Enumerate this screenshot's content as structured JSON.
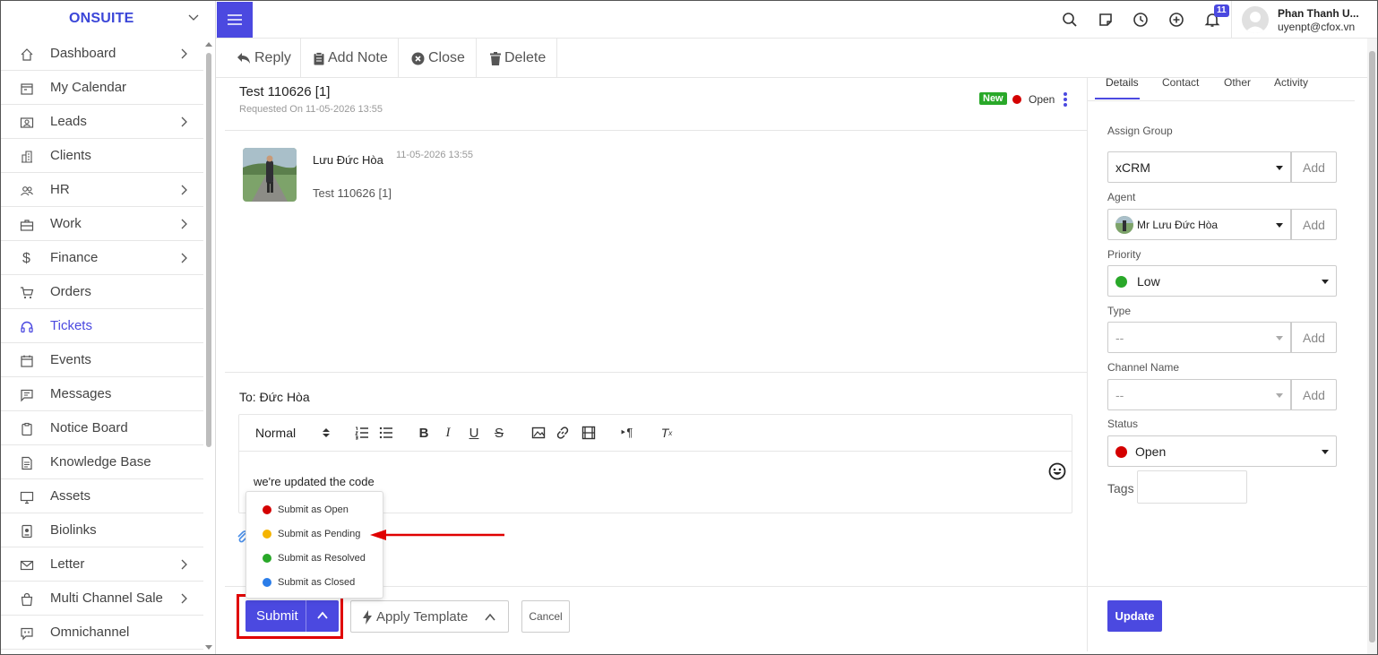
{
  "brand": "ONSUITE",
  "sidebar": {
    "items": [
      {
        "label": "Dashboard",
        "icon": "home-icon",
        "arrow": true
      },
      {
        "label": "My Calendar",
        "icon": "calendar-icon",
        "arrow": false
      },
      {
        "label": "Leads",
        "icon": "contact-card-icon",
        "arrow": true
      },
      {
        "label": "Clients",
        "icon": "building-icon",
        "arrow": false
      },
      {
        "label": "HR",
        "icon": "people-icon",
        "arrow": true
      },
      {
        "label": "Work",
        "icon": "briefcase-icon",
        "arrow": true
      },
      {
        "label": "Finance",
        "icon": "dollar-icon",
        "arrow": true
      },
      {
        "label": "Orders",
        "icon": "cart-icon",
        "arrow": false
      },
      {
        "label": "Tickets",
        "icon": "headset-icon",
        "arrow": false,
        "active": true
      },
      {
        "label": "Events",
        "icon": "event-calendar-icon",
        "arrow": false
      },
      {
        "label": "Messages",
        "icon": "message-icon",
        "arrow": false
      },
      {
        "label": "Notice Board",
        "icon": "clipboard-icon",
        "arrow": false
      },
      {
        "label": "Knowledge Base",
        "icon": "document-icon",
        "arrow": false
      },
      {
        "label": "Assets",
        "icon": "monitor-icon",
        "arrow": false
      },
      {
        "label": "Biolinks",
        "icon": "id-badge-icon",
        "arrow": false
      },
      {
        "label": "Letter",
        "icon": "envelope-icon",
        "arrow": true
      },
      {
        "label": "Multi Channel Sale",
        "icon": "shopping-bag-icon",
        "arrow": true
      },
      {
        "label": "Omnichannel",
        "icon": "chat-quote-icon",
        "arrow": false
      }
    ]
  },
  "topbar": {
    "notification_count": "11",
    "user_name": "Phan Thanh U...",
    "user_email": "uyenpt@cfox.vn"
  },
  "toolbar": {
    "reply": "Reply",
    "add_note": "Add Note",
    "close": "Close",
    "delete": "Delete"
  },
  "ticket": {
    "title": "Test 110626 [1]",
    "requested": "Requested On 11-05-2026 13:55",
    "new_badge": "New",
    "status": "Open"
  },
  "message": {
    "author": "Lưu Đức Hòa",
    "time": "11-05-2026 13:55",
    "body": "Test 110626 [1]"
  },
  "reply": {
    "to": "To: Đức Hòa",
    "format": "Normal",
    "text": "we're updated the code"
  },
  "submit_menu": [
    {
      "label": "Submit as Open",
      "color": "#d40000"
    },
    {
      "label": "Submit as Pending",
      "color": "#f5b400"
    },
    {
      "label": "Submit as Resolved",
      "color": "#29a829"
    },
    {
      "label": "Submit as Closed",
      "color": "#2b7de9"
    }
  ],
  "footer": {
    "submit": "Submit",
    "apply_template": "Apply Template",
    "cancel": "Cancel"
  },
  "panel": {
    "tabs": [
      "Details",
      "Contact",
      "Other",
      "Activity"
    ],
    "assign_group_label": "Assign Group",
    "assign_group_value": "xCRM",
    "agent_label": "Agent",
    "agent_value": "Mr Lưu Đức Hòa",
    "priority_label": "Priority",
    "priority_value": "Low",
    "type_label": "Type",
    "type_value": "--",
    "channel_label": "Channel Name",
    "channel_value": "--",
    "status_label": "Status",
    "status_value": "Open",
    "tags_label": "Tags",
    "add_label": "Add",
    "update": "Update"
  },
  "colors": {
    "accent": "#4b49e0",
    "open": "#d40000",
    "low": "#29a829",
    "highlight": "#e00000"
  }
}
